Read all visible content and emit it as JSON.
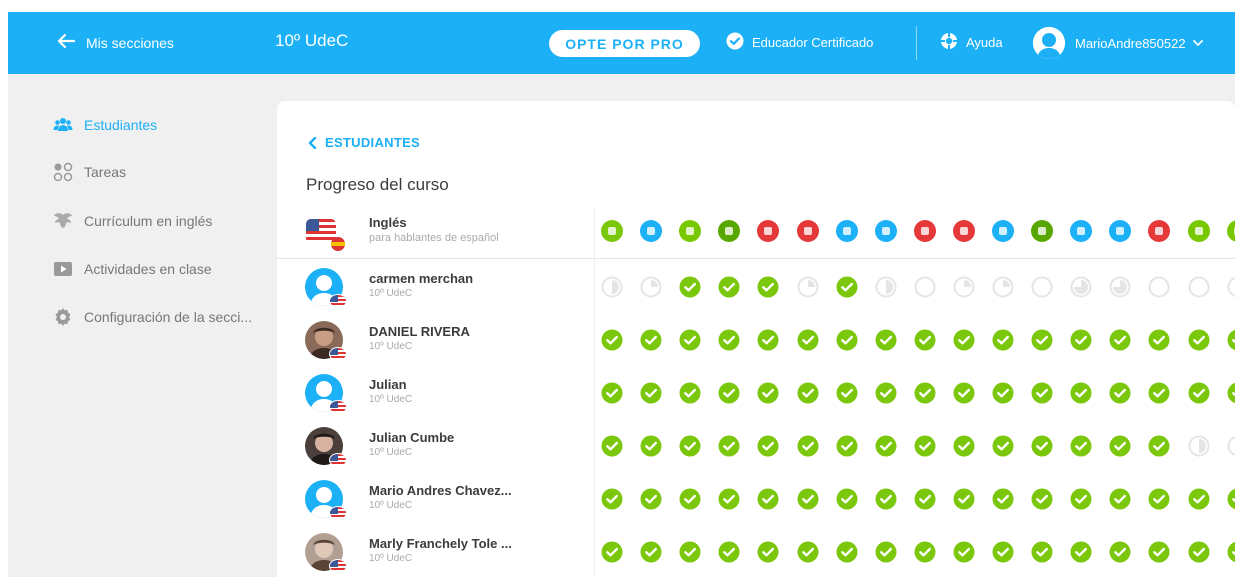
{
  "topbar": {
    "back_label": "Mis secciones",
    "section_title": "10º UdeC",
    "pro_button": "OPTE POR PRO",
    "certified": "Educador Certificado",
    "help": "Ayuda",
    "username": "MarioAndre850522"
  },
  "sidebar": {
    "items": [
      {
        "label": "Estudiantes",
        "icon": "students-icon",
        "active": true
      },
      {
        "label": "Tareas",
        "icon": "tasks-icon",
        "active": false
      },
      {
        "label": "Currículum en inglés",
        "icon": "curriculum-icon",
        "active": false
      },
      {
        "label": "Actividades en clase",
        "icon": "play-icon",
        "active": false
      },
      {
        "label": "Configuración de la secci...",
        "icon": "gear-icon",
        "active": false
      }
    ]
  },
  "main": {
    "breadcrumb": "ESTUDIANTES",
    "heading": "Progreso del curso",
    "course": {
      "name": "Inglés",
      "subtitle": "para hablantes de español"
    },
    "skill_colors": [
      "#7ac70c",
      "#1cb0f6",
      "#78c800",
      "#58a700",
      "#e53838",
      "#e53838",
      "#1cb0f6",
      "#1cb0f6",
      "#e53838",
      "#e53838",
      "#1cb0f6",
      "#58a700",
      "#1cb0f6",
      "#1cb0f6",
      "#e53838",
      "#78c800",
      "#78c800"
    ],
    "students": [
      {
        "name": "carmen merchan",
        "section": "10º UdeC",
        "avatar": "default",
        "progress": [
          "half",
          "quarter",
          "done",
          "done",
          "done",
          "quarter",
          "done",
          "half",
          "empty",
          "quarter",
          "quarter",
          "empty",
          "three",
          "three",
          "empty",
          "empty",
          "empty"
        ]
      },
      {
        "name": "DANIEL RIVERA",
        "section": "10º UdeC",
        "avatar": "photo1",
        "progress": [
          "done",
          "done",
          "done",
          "done",
          "done",
          "done",
          "done",
          "done",
          "done",
          "done",
          "done",
          "done",
          "done",
          "done",
          "done",
          "done",
          "done"
        ]
      },
      {
        "name": "Julian",
        "section": "10º UdeC",
        "avatar": "default",
        "progress": [
          "done",
          "done",
          "done",
          "done",
          "done",
          "done",
          "done",
          "done",
          "done",
          "done",
          "done",
          "done",
          "done",
          "done",
          "done",
          "done",
          "done"
        ]
      },
      {
        "name": "Julian Cumbe",
        "section": "10º UdeC",
        "avatar": "photo2",
        "progress": [
          "done",
          "done",
          "done",
          "done",
          "done",
          "done",
          "done",
          "done",
          "done",
          "done",
          "done",
          "done",
          "done",
          "done",
          "done",
          "half",
          "empty"
        ]
      },
      {
        "name": "Mario Andres Chavez...",
        "section": "10º UdeC",
        "avatar": "default",
        "progress": [
          "done",
          "done",
          "done",
          "done",
          "done",
          "done",
          "done",
          "done",
          "done",
          "done",
          "done",
          "done",
          "done",
          "done",
          "done",
          "done",
          "done"
        ]
      },
      {
        "name": "Marly Franchely Tole ...",
        "section": "10º UdeC",
        "avatar": "photo3",
        "progress": [
          "done",
          "done",
          "done",
          "done",
          "done",
          "done",
          "done",
          "done",
          "done",
          "done",
          "done",
          "done",
          "done",
          "done",
          "done",
          "done",
          "done"
        ]
      }
    ]
  },
  "colors": {
    "brand": "#1cb0f6",
    "done": "#7ac70c",
    "incomplete": "#e5e5e5"
  }
}
